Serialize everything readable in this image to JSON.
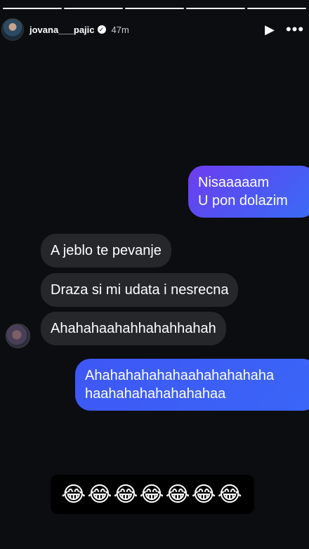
{
  "story": {
    "progress_segments": 5,
    "progress_done": 5
  },
  "header": {
    "username": "jovana___pajic",
    "verified_icon": "✓",
    "time": "47m",
    "play_icon": "▶",
    "more_icon": "•••"
  },
  "messages": {
    "sent_1": "Nisaaaaam\nU pon dolazim",
    "recv_1": "A jeblo te pevanje",
    "recv_2": "Draza si mi udata i nesrecna",
    "recv_3": "Ahahahaahahhahahhahah",
    "sent_2": "Ahahahahahahaahahahahaha haahahahahahahahaa"
  },
  "emoji_sticker": "😂😂😂😂😂😂😂"
}
